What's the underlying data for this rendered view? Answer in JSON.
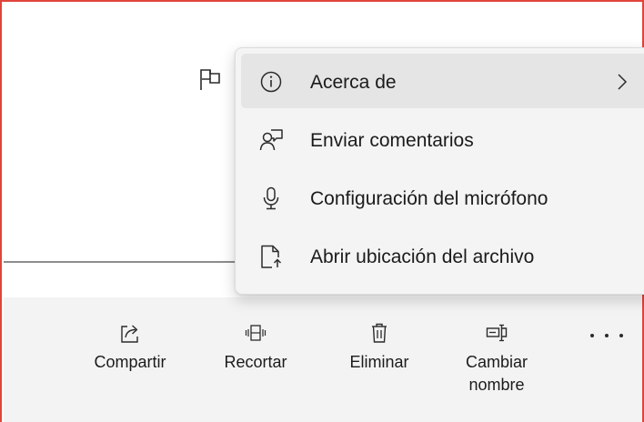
{
  "context_menu": {
    "items": [
      {
        "label": "Acerca de",
        "icon": "info-icon",
        "has_submenu": true
      },
      {
        "label": "Enviar comentarios",
        "icon": "feedback-icon"
      },
      {
        "label": "Configuración del micrófono",
        "icon": "microphone-icon"
      },
      {
        "label": "Abrir ubicación del archivo",
        "icon": "open-file-location-icon"
      }
    ]
  },
  "toolbar": {
    "share_label": "Compartir",
    "trim_label": "Recortar",
    "delete_label": "Eliminar",
    "rename_label": "Cambiar\nnombre",
    "more_icon": "more-options-icon"
  },
  "colors": {
    "frame_border": "#e0443a",
    "menu_background": "#f4f4f4",
    "menu_hover": "#e5e5e5",
    "toolbar_background": "#f3f3f3"
  }
}
